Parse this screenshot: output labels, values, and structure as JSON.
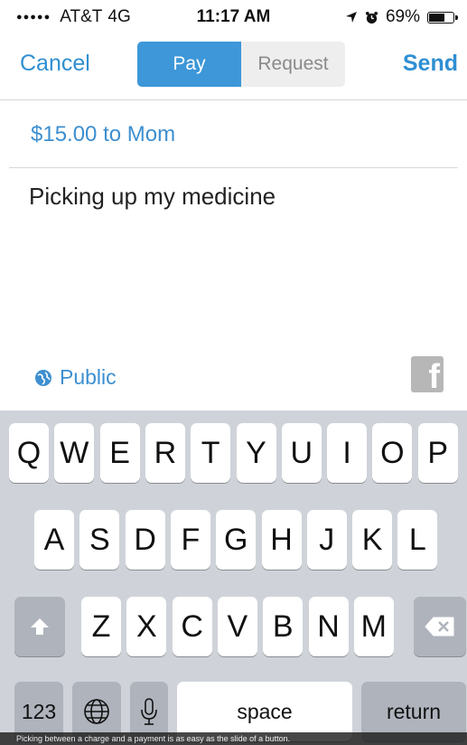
{
  "status_bar": {
    "signal_dots": "●●●●●",
    "carrier": "AT&T",
    "network": "4G",
    "time": "11:17 AM",
    "battery_percent": "69%",
    "battery_level": 0.69
  },
  "nav": {
    "cancel_label": "Cancel",
    "segments": [
      "Pay",
      "Request"
    ],
    "selected_segment": "Pay",
    "send_label": "Send",
    "accent_color": "#2f8fd2"
  },
  "payment": {
    "summary": "$15.00 to Mom",
    "note": "Picking up my medicine",
    "visibility": "Public",
    "facebook_glyph": "f"
  },
  "keyboard": {
    "row1": [
      "Q",
      "W",
      "E",
      "R",
      "T",
      "Y",
      "U",
      "I",
      "O",
      "P"
    ],
    "row2": [
      "A",
      "S",
      "D",
      "F",
      "G",
      "H",
      "J",
      "K",
      "L"
    ],
    "row3": [
      "Z",
      "X",
      "C",
      "V",
      "B",
      "N",
      "M"
    ],
    "numbers_label": "123",
    "space_label": "space",
    "return_label": "return"
  },
  "caption": "Picking between a charge and a payment is as easy as the slide of a button."
}
